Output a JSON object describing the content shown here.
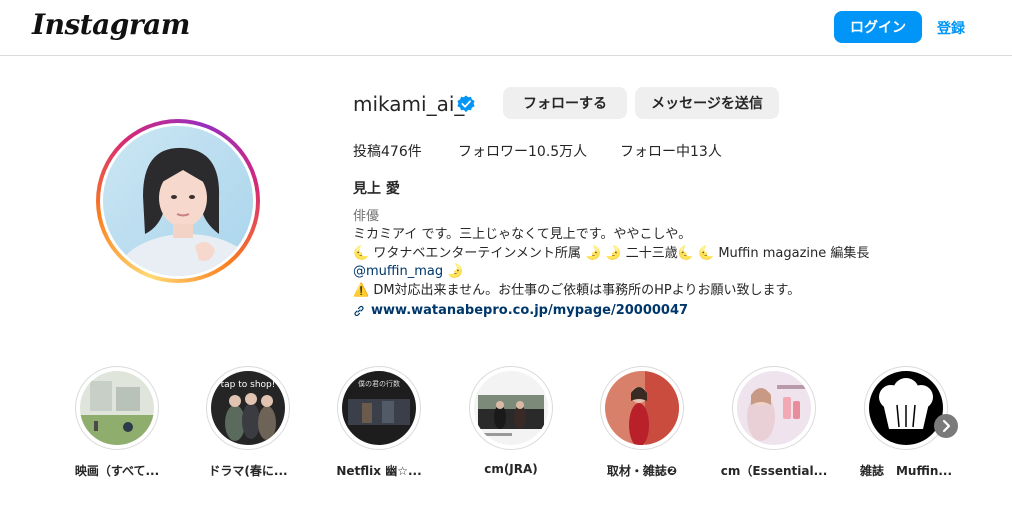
{
  "header": {
    "logo": "Instagram",
    "login_label": "ログイン",
    "register_label": "登録"
  },
  "profile": {
    "username": "mikami_ai_",
    "follow_label": "フォローする",
    "message_label": "メッセージを送信",
    "stats": {
      "posts": "投稿476件",
      "followers": "フォロワー10.5万人",
      "following": "フォロー中13人"
    },
    "full_name": "見上 愛",
    "category": "俳優",
    "bio": {
      "line1": "ミカミアイ です。三上じゃなくて見上です。ややこしや。",
      "line2": "🌜 ワタナベエンターテインメント所属 🌛 🌛 二十三歳🌜 🌜 Muffin magazine 編集長",
      "mention": "@muffin_mag",
      "mention_suffix": " 🌛",
      "line4": "⚠️ DM対応出来ません。お仕事のご依頼は事務所のHPよりお願い致します。"
    },
    "website": "www.watanabepro.co.jp/mypage/20000047"
  },
  "highlights": [
    {
      "label": "映画（すべて..."
    },
    {
      "label": "ドラマ(春に..."
    },
    {
      "label": "Netflix 幽☆..."
    },
    {
      "label": "cm(JRA)"
    },
    {
      "label": "取材・雑誌❷"
    },
    {
      "label": "cm（Essential..."
    },
    {
      "label": "雑誌　Muffin..."
    }
  ],
  "highlight_thumb_texts": {
    "drama": "tap to shop!",
    "netflix": "僕の君の行数"
  },
  "colors": {
    "accent": "#0095f6",
    "verified": "#0095f6",
    "link": "#00376b",
    "button_grey": "#efefef"
  }
}
